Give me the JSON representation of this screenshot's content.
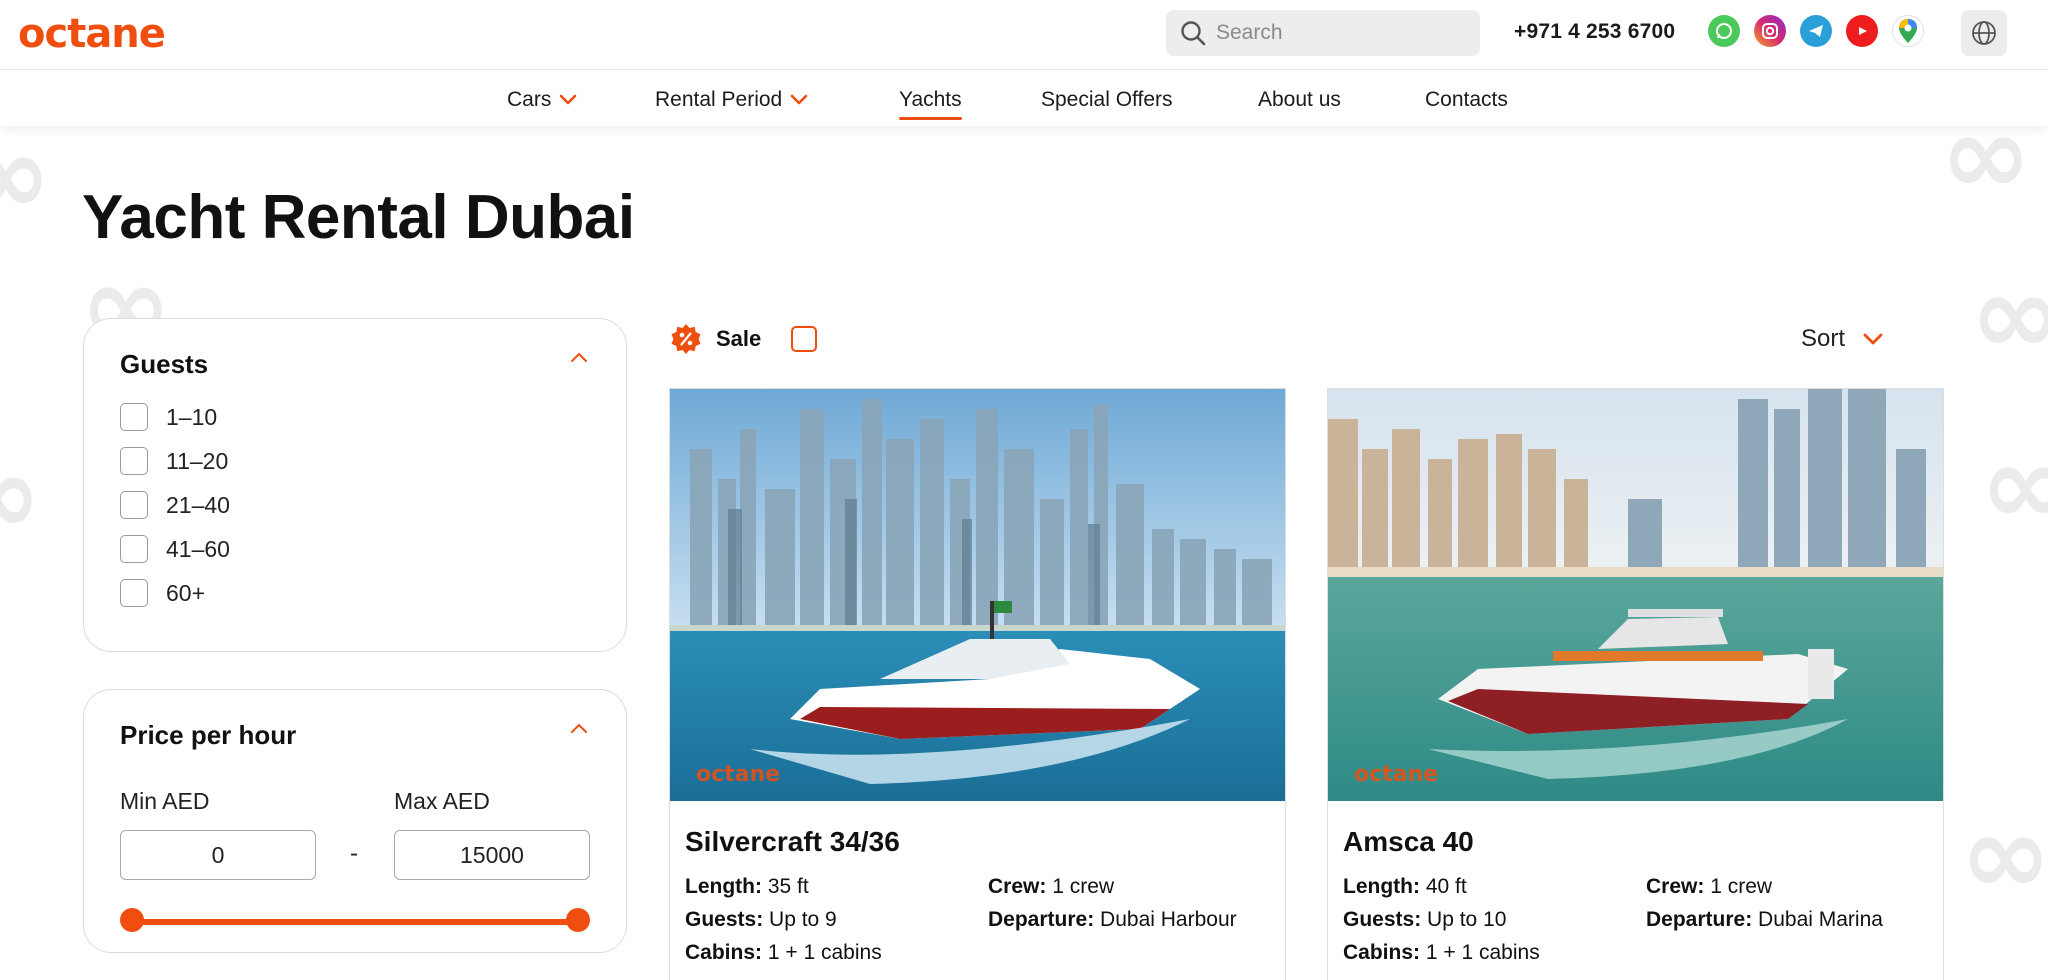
{
  "brand": {
    "logo_text": "octane",
    "accent": "#f04e0f"
  },
  "header": {
    "search_placeholder": "Search",
    "phone": "+971 4 253 6700",
    "socials": [
      {
        "name": "whatsapp-icon",
        "color": "#4cc95b"
      },
      {
        "name": "instagram-icon",
        "color": "#d6296f"
      },
      {
        "name": "telegram-icon",
        "color": "#2a9fd9"
      },
      {
        "name": "youtube-icon",
        "color": "#ee1c1c"
      },
      {
        "name": "maps-icon",
        "color": "#4285f4"
      }
    ],
    "language_icon": "globe-icon"
  },
  "nav": {
    "items": [
      {
        "label": "Cars",
        "has_dropdown": true
      },
      {
        "label": "Rental Period",
        "has_dropdown": true
      },
      {
        "label": "Yachts",
        "active": true
      },
      {
        "label": "Special Offers"
      },
      {
        "label": "About us"
      },
      {
        "label": "Contacts"
      }
    ]
  },
  "page": {
    "title": "Yacht Rental Dubai"
  },
  "filters": {
    "guests": {
      "title": "Guests",
      "options": [
        "1–10",
        "11–20",
        "21–40",
        "41–60",
        "60+"
      ]
    },
    "price": {
      "title": "Price per hour",
      "min_label": "Min AED",
      "max_label": "Max AED",
      "min_value": "0",
      "max_value": "15000",
      "separator": "-"
    }
  },
  "toolbar": {
    "sale_label": "Sale",
    "sort_label": "Sort"
  },
  "yachts": [
    {
      "name": "Silvercraft 34/36",
      "image_watermark": "octane",
      "specs": {
        "length_label": "Length:",
        "length": "35 ft",
        "crew_label": "Crew:",
        "crew": "1 crew",
        "guests_label": "Guests:",
        "guests": "Up to 9",
        "departure_label": "Departure:",
        "departure": "Dubai Harbour",
        "cabins_label": "Cabins:",
        "cabins": "1 + 1 cabins"
      }
    },
    {
      "name": "Amsca 40",
      "image_watermark": "octane",
      "specs": {
        "length_label": "Length:",
        "length": "40 ft",
        "crew_label": "Crew:",
        "crew": "1 crew",
        "guests_label": "Guests:",
        "guests": "Up to 10",
        "departure_label": "Departure:",
        "departure": "Dubai Marina",
        "cabins_label": "Cabins:",
        "cabins": "1 + 1 cabins"
      }
    }
  ]
}
